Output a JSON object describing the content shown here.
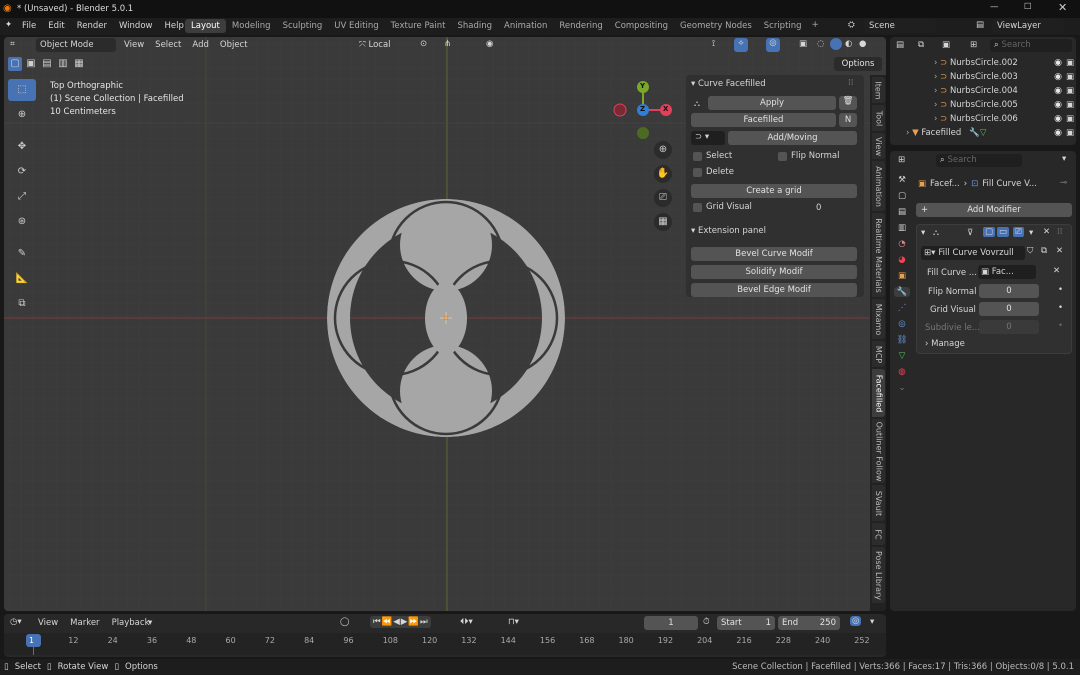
{
  "titlebar": {
    "title": "* (Unsaved) - Blender 5.0.1"
  },
  "menu": [
    "File",
    "Edit",
    "Render",
    "Window",
    "Help"
  ],
  "workspaces": [
    "Layout",
    "Modeling",
    "Sculpting",
    "UV Editing",
    "Texture Paint",
    "Shading",
    "Animation",
    "Rendering",
    "Compositing",
    "Geometry Nodes",
    "Scripting"
  ],
  "active_workspace": "Layout",
  "scene": {
    "scene_name": "Scene",
    "view_layer": "ViewLayer"
  },
  "viewport_header": {
    "mode": "Object Mode",
    "menus": [
      "View",
      "Select",
      "Add",
      "Object"
    ],
    "transform": "Local",
    "options": "Options"
  },
  "viewport_info": {
    "line1": "Top Orthographic",
    "line2": "(1) Scene Collection | Facefilled",
    "line3": "10 Centimeters"
  },
  "gizmo": {
    "y": "Y",
    "z": "Z",
    "x": "X"
  },
  "curve_panel": {
    "title": "Curve Facefilled",
    "apply": "Apply",
    "facefilled": "Facefilled",
    "shortcut": "N",
    "add_moving": "Add/Moving",
    "select": "Select",
    "flip_normal": "Flip Normal",
    "delete": "Delete",
    "create_grid": "Create a grid",
    "grid_visual": "Grid Visual",
    "grid_visual_value": "0"
  },
  "extension_panel": {
    "title": "Extension panel",
    "buttons": [
      "Bevel Curve Modif",
      "Solidify Modif",
      "Bevel Edge Modif"
    ]
  },
  "side_tabs": [
    "Item",
    "Tool",
    "View",
    "Animation",
    "Realtime Materials",
    "Mixamo",
    "MCP",
    "Facefilled",
    "Outliner Follow",
    "SVault",
    "FC",
    "Pose Library"
  ],
  "outliner": {
    "items": [
      "NurbsCircle.002",
      "NurbsCircle.003",
      "NurbsCircle.004",
      "NurbsCircle.005",
      "NurbsCircle.006"
    ],
    "facefilled": "Facefilled",
    "search_placeholder": "Search"
  },
  "properties": {
    "search_placeholder": "Search",
    "breadcrumb_obj": "Facef...",
    "breadcrumb_mod": "Fill Curve V...",
    "add_modifier": "Add Modifier",
    "node_group": "Fill Curve Vovrzull",
    "fill_curve_label": "Fill Curve ...",
    "fill_curve_value": "Fac...",
    "flip_normal": "Flip Normal",
    "flip_value": "0",
    "grid_visual": "Grid Visual",
    "grid_value": "0",
    "subdivide": "Subdivie le...",
    "subdivide_value": "0",
    "manage": "Manage"
  },
  "timeline": {
    "menus": [
      "View",
      "Marker",
      "Playback"
    ],
    "current_frame": "1",
    "start_label": "Start",
    "start": "1",
    "end_label": "End",
    "end": "250",
    "ticks": [
      "1",
      "12",
      "24",
      "36",
      "48",
      "60",
      "72",
      "84",
      "96",
      "108",
      "120",
      "132",
      "144",
      "156",
      "168",
      "180",
      "192",
      "204",
      "216",
      "228",
      "240",
      "252"
    ]
  },
  "statusbar": {
    "select": "Select",
    "rotate": "Rotate View",
    "options": "Options",
    "stats": "Scene Collection | Facefilled | Verts:366 | Faces:17 | Tris:366 | Objects:0/8 | 5.0.1"
  },
  "colors": {
    "accent": "#4772b3",
    "gizmo_x": "#e0405a",
    "gizmo_y": "#7aa82a",
    "gizmo_z": "#2f7fd8",
    "shape": "#a6a6a6"
  }
}
